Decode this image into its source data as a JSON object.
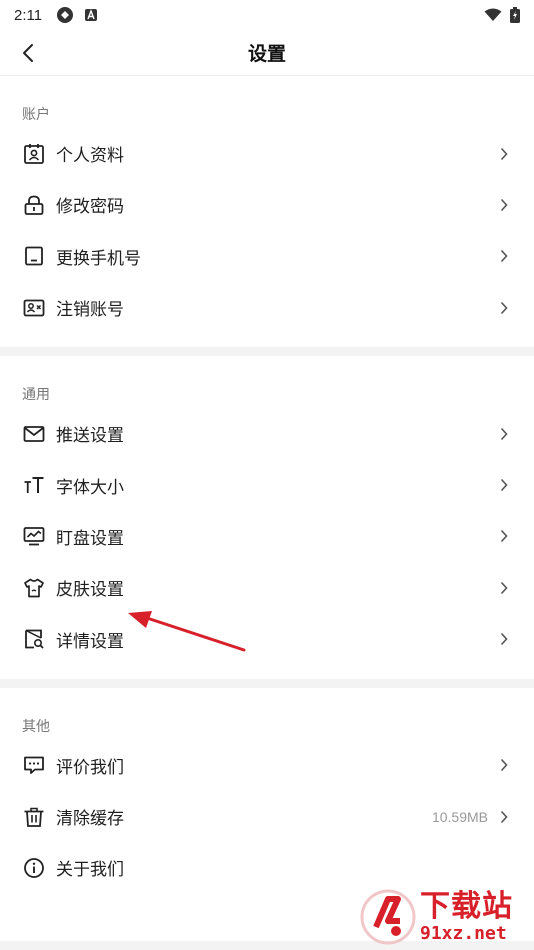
{
  "status_bar": {
    "time": "2:11"
  },
  "header": {
    "title": "设置"
  },
  "sections": {
    "account": {
      "label": "账户",
      "items": [
        {
          "label": "个人资料",
          "icon": "profile-card-icon"
        },
        {
          "label": "修改密码",
          "icon": "lock-icon"
        },
        {
          "label": "更换手机号",
          "icon": "phone-icon"
        },
        {
          "label": "注销账号",
          "icon": "id-card-x-icon"
        }
      ]
    },
    "general": {
      "label": "通用",
      "items": [
        {
          "label": "推送设置",
          "icon": "mail-icon"
        },
        {
          "label": "字体大小",
          "icon": "font-size-icon"
        },
        {
          "label": "盯盘设置",
          "icon": "monitor-chart-icon"
        },
        {
          "label": "皮肤设置",
          "icon": "shirt-icon"
        },
        {
          "label": "详情设置",
          "icon": "detail-search-icon"
        }
      ]
    },
    "other": {
      "label": "其他",
      "items": [
        {
          "label": "评价我们",
          "icon": "message-icon"
        },
        {
          "label": "清除缓存",
          "icon": "trash-icon",
          "value": "10.59MB"
        },
        {
          "label": "关于我们",
          "icon": "info-icon"
        }
      ]
    }
  },
  "watermark": {
    "main": "下载站",
    "sub": "91xz.net"
  },
  "colors": {
    "accent": "#d8202a",
    "divider": "#f3f3f3",
    "text": "#1f1f1f",
    "muted": "#777777"
  }
}
